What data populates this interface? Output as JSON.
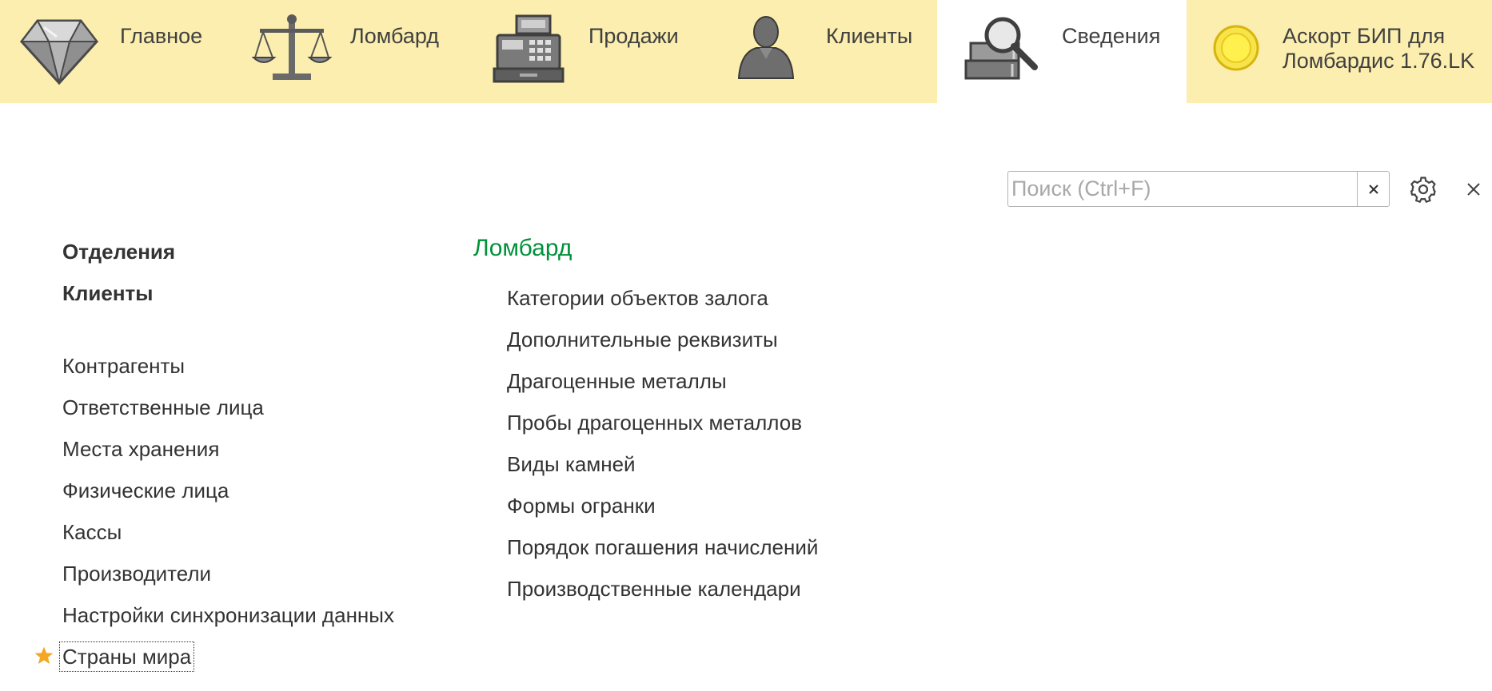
{
  "sections": [
    {
      "label": "Главное",
      "icon": "diamond-icon"
    },
    {
      "label": "Ломбард",
      "icon": "scales-icon"
    },
    {
      "label": "Продажи",
      "icon": "cash-register-icon"
    },
    {
      "label": "Клиенты",
      "icon": "person-icon"
    },
    {
      "label": "Сведения",
      "icon": "books-magnifier-icon",
      "active": true
    },
    {
      "label_line1": "Аскорт БИП для",
      "label_line2": "Ломбардис 1.76.LK",
      "icon": "yellow-circle-icon"
    }
  ],
  "toolbar": {
    "search_placeholder": "Поиск (Ctrl+F)",
    "search_value": "",
    "clear_icon": "close-icon",
    "settings_icon": "gear-icon",
    "close_icon": "close-icon"
  },
  "left_column": {
    "bold_items": [
      "Отделения",
      "Клиенты"
    ],
    "items": [
      "Контрагенты",
      "Ответственные лица",
      "Места хранения",
      "Физические лица",
      "Кассы",
      "Производители",
      "Настройки синхронизации данных",
      "Страны мира"
    ],
    "favorite_icon": "star-icon"
  },
  "right_column": {
    "title": "Ломбард",
    "items": [
      "Категории объектов залога",
      "Дополнительные реквизиты",
      "Драгоценные металлы",
      "Пробы драгоценных металлов",
      "Виды камней",
      "Формы огранки",
      "Порядок погашения начислений",
      "Производственные календари"
    ]
  },
  "colors": {
    "topbar_bg": "#fbeeae",
    "active_tab_bg": "#ffffff",
    "group_title": "#00913a",
    "star": "#f5a623",
    "text": "#333333"
  }
}
